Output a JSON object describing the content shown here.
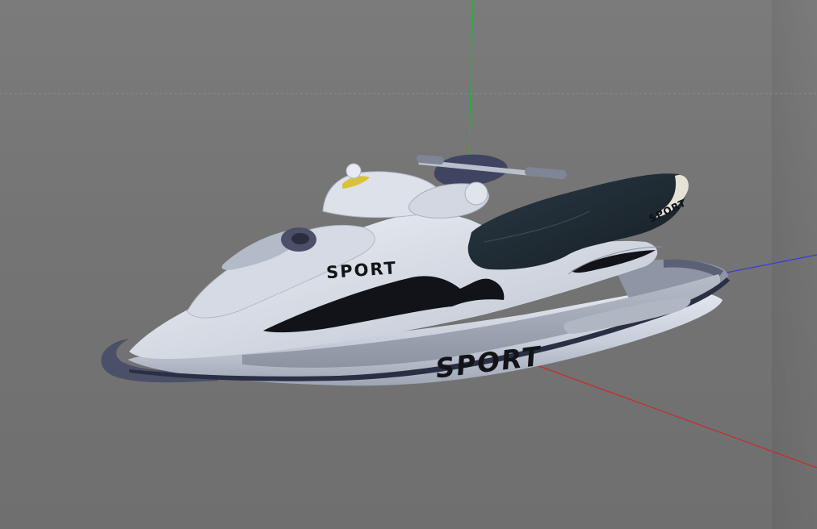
{
  "viewport": {
    "background": "#767676",
    "horizon_line_color": "#8e8e8e",
    "axes": {
      "x_color": "#cc2a2a",
      "y_color": "#22b533",
      "z_color": "#3b3bd6"
    }
  },
  "model": {
    "name": "jet-ski",
    "hull_color": "#c6ccd8",
    "hull_shadow": "#9aa0ad",
    "seat_color": "#1e2a33",
    "trim_color": "#4a4f66",
    "logo_color": "#d8c23a",
    "decals": {
      "front": "SPORT",
      "side": "SPORT",
      "seat": "SPORT"
    }
  }
}
